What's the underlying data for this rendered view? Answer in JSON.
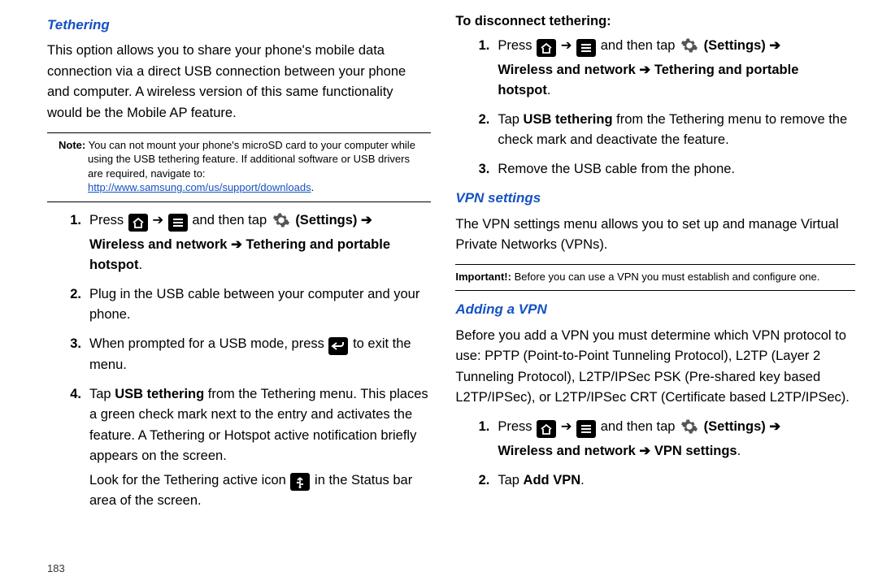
{
  "page_number": "183",
  "left": {
    "tethering": {
      "heading": "Tethering",
      "intro": "This option allows you to share your phone's mobile data connection via a direct USB connection between your phone and computer. A wireless version of this same functionality would be the Mobile AP feature.",
      "note_label": "Note:",
      "note_text": "You can not mount your phone's microSD card to your computer while using the USB tethering feature. If additional software or USB drivers are required, navigate to: ",
      "note_link": "http://www.samsung.com/us/support/downloads",
      "note_period": ".",
      "steps": {
        "s1_a": "Press ",
        "s1_arrow": " ➔ ",
        "s1_b": " and then tap ",
        "s1_settings": "(Settings)",
        "s1_arrow2": " ➔ ",
        "s1_line2": "Wireless and network ➔ Tethering and portable hotspot",
        "s1_end": ".",
        "s2": "Plug in the USB cable between your computer and your phone.",
        "s3_a": "When prompted for a USB mode, press ",
        "s3_b": " to exit the menu.",
        "s4_a": "Tap ",
        "s4_bold": "USB tethering",
        "s4_b": " from the Tethering menu. This places a green check mark next to the entry and activates the feature. A Tethering or Hotspot active notification briefly appears on the screen.",
        "s4_c": "Look for the Tethering active icon ",
        "s4_d": " in the Status bar area of the screen."
      }
    }
  },
  "right": {
    "disconnect": {
      "heading": "To disconnect tethering:",
      "s1_a": "Press ",
      "s1_arrow": " ➔ ",
      "s1_b": " and then tap ",
      "s1_settings": "(Settings)",
      "s1_arrow2": " ➔ ",
      "s1_line2": "Wireless and network ➔ Tethering and portable hotspot",
      "s1_end": ".",
      "s2_a": "Tap ",
      "s2_bold": "USB tethering",
      "s2_b": " from the Tethering menu to remove the check mark and deactivate the feature.",
      "s3": "Remove the USB cable from the phone."
    },
    "vpn": {
      "heading": "VPN settings",
      "intro": "The VPN settings menu allows you to set up and manage Virtual Private Networks (VPNs).",
      "note_label": "Important!:",
      "note_text": "Before you can use a VPN you must establish and configure one."
    },
    "add_vpn": {
      "heading": "Adding a VPN",
      "intro": "Before you add a VPN you must determine which VPN protocol to use: PPTP (Point-to-Point Tunneling Protocol), L2TP (Layer 2 Tunneling Protocol), L2TP/IPSec PSK (Pre-shared key based L2TP/IPSec), or L2TP/IPSec CRT (Certificate based L2TP/IPSec).",
      "s1_a": "Press ",
      "s1_arrow": " ➔ ",
      "s1_b": " and then tap ",
      "s1_settings": "(Settings)",
      "s1_arrow2": " ➔ ",
      "s1_line2": "Wireless and network ➔ VPN settings",
      "s1_end": ".",
      "s2_a": "Tap ",
      "s2_bold": "Add VPN",
      "s2_end": "."
    }
  }
}
